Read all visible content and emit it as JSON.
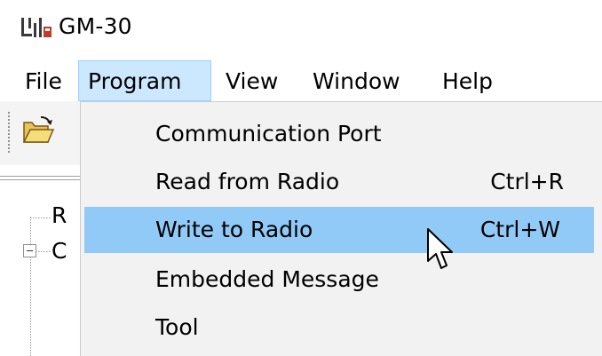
{
  "window": {
    "title": "GM-30",
    "icon": "app-logo-icon"
  },
  "menubar": {
    "items": [
      {
        "label": "File",
        "active": false
      },
      {
        "label": "Program",
        "active": true
      },
      {
        "label": "View",
        "active": false
      },
      {
        "label": "Window",
        "active": false
      },
      {
        "label": "Help",
        "active": false
      }
    ]
  },
  "toolbar": {
    "open_icon": "folder-open-icon"
  },
  "tree": {
    "item1_fragment": "R",
    "item2_fragment": "C"
  },
  "dropdown": {
    "items": [
      {
        "label": "Communication Port",
        "shortcut": ""
      },
      {
        "label": "Read from Radio",
        "shortcut": "Ctrl+R"
      },
      {
        "label": "Write to Radio",
        "shortcut": "Ctrl+W",
        "highlighted": true
      },
      {
        "label": "Embedded Message",
        "shortcut": ""
      },
      {
        "label": "Tool",
        "shortcut": ""
      }
    ]
  },
  "colors": {
    "menu_active_bg": "#cce8ff",
    "menu_active_border": "#99d1ff",
    "dropdown_bg": "#f2f2f2",
    "dropdown_highlight": "#91c9f7"
  }
}
